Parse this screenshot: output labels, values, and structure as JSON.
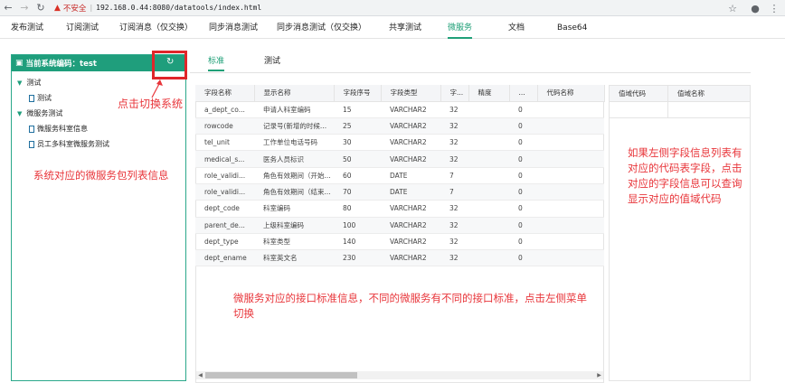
{
  "browser": {
    "insecure_label": "不安全",
    "url": "192.168.0.44:8080/datatools/index.html"
  },
  "menu": [
    {
      "label": "发布测试"
    },
    {
      "label": "订阅测试"
    },
    {
      "label": "订阅消息（仅交换）"
    },
    {
      "label": "同步消息测试"
    },
    {
      "label": "同步消息测试（仅交换）"
    },
    {
      "label": "共享测试"
    },
    {
      "label": "微服务",
      "active": true
    },
    {
      "label": "文档"
    },
    {
      "label": "Base64"
    }
  ],
  "left_panel": {
    "title": "当前系统编码：test",
    "tree": [
      {
        "label": "测试",
        "level": 0
      },
      {
        "label": "测试",
        "level": 1
      },
      {
        "label": "微服务测试",
        "level": 0
      },
      {
        "label": "微服务科室信息",
        "level": 1
      },
      {
        "label": "员工多科室微服务测试",
        "level": 1
      }
    ]
  },
  "annotations": {
    "switch_system": "点击切换系统",
    "left_list": "系统对应的微服务包列表信息",
    "right_note": "如果左侧字段信息列表有对应的代码表字段，点击对应的字段信息可以查询显示对应的值域代码",
    "bottom_note": "微服务对应的接口标准信息，不同的微服务有不同的接口标准，点击左侧菜单切换"
  },
  "tabs": [
    {
      "label": "标准",
      "active": true
    },
    {
      "label": "测试"
    }
  ],
  "table": {
    "headers": [
      "字段名称",
      "显示名称",
      "字段序号",
      "字段类型",
      "字...",
      "精度",
      "...",
      "代码名称"
    ],
    "rows": [
      [
        "a_dept_co...",
        "申请人科室编码",
        "15",
        "VARCHAR2",
        "32",
        "",
        "0",
        ""
      ],
      [
        "rowcode",
        "记录号(新增的时候...",
        "25",
        "VARCHAR2",
        "32",
        "",
        "0",
        ""
      ],
      [
        "tel_unit",
        "工作单位电话号码",
        "30",
        "VARCHAR2",
        "32",
        "",
        "0",
        ""
      ],
      [
        "medical_s...",
        "医务人员标识",
        "50",
        "VARCHAR2",
        "32",
        "",
        "0",
        ""
      ],
      [
        "role_validi...",
        "角色有效期间（开始...",
        "60",
        "DATE",
        "7",
        "",
        "0",
        ""
      ],
      [
        "role_validi...",
        "角色有效期间（结束...",
        "70",
        "DATE",
        "7",
        "",
        "0",
        ""
      ],
      [
        "dept_code",
        "科室编码",
        "80",
        "VARCHAR2",
        "32",
        "",
        "0",
        ""
      ],
      [
        "parent_de...",
        "上级科室编码",
        "100",
        "VARCHAR2",
        "32",
        "",
        "0",
        ""
      ],
      [
        "dept_type",
        "科室类型",
        "140",
        "VARCHAR2",
        "32",
        "",
        "0",
        ""
      ],
      [
        "dept_ename",
        "科室英文名",
        "230",
        "VARCHAR2",
        "32",
        "",
        "0",
        ""
      ]
    ]
  },
  "right_table": {
    "headers": [
      "值域代码",
      "值域名称"
    ]
  },
  "colors": {
    "accent": "#1f9e7c",
    "annotation": "#e8353a"
  }
}
